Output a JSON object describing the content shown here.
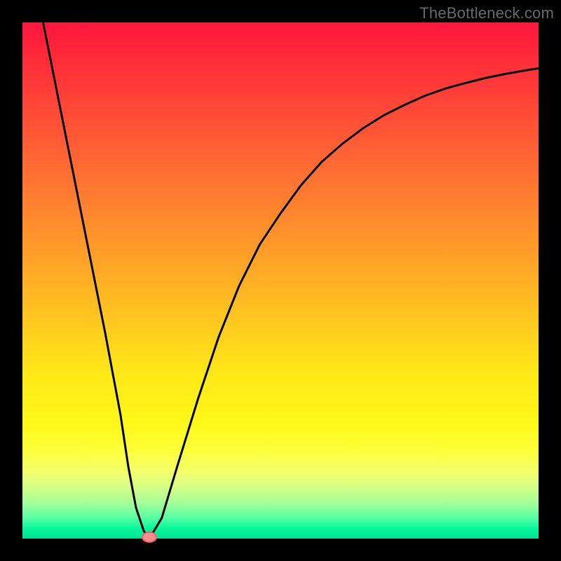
{
  "watermark": "TheBottleneck.com",
  "chart_data": {
    "type": "line",
    "title": "",
    "xlabel": "",
    "ylabel": "",
    "xlim": [
      0,
      100
    ],
    "ylim": [
      0,
      100
    ],
    "grid": false,
    "series": [
      {
        "name": "curve",
        "x": [
          4,
          8,
          12,
          16,
          19,
          20.5,
          22,
          23.5,
          24.6,
          27,
          30,
          34,
          38,
          42,
          46,
          50,
          54,
          58,
          62,
          66,
          70,
          74,
          78,
          82,
          86,
          90,
          94,
          98,
          100
        ],
        "y": [
          100,
          80,
          60,
          40,
          24,
          14,
          6,
          1.5,
          0,
          4,
          14,
          27,
          39,
          49,
          57,
          63,
          68.5,
          73,
          76.5,
          79.5,
          82,
          84,
          85.8,
          87.2,
          88.3,
          89.3,
          90.1,
          90.8,
          91.1
        ],
        "color": "#000000"
      }
    ],
    "marker": {
      "x": 24.6,
      "y": 0,
      "color": "#ff8e8e"
    },
    "gradient_stops": [
      {
        "pos": 0,
        "color": "#ff153d"
      },
      {
        "pos": 20,
        "color": "#ff5236"
      },
      {
        "pos": 46,
        "color": "#ffa228"
      },
      {
        "pos": 78,
        "color": "#fff81a"
      },
      {
        "pos": 100,
        "color": "#00e394"
      }
    ]
  }
}
